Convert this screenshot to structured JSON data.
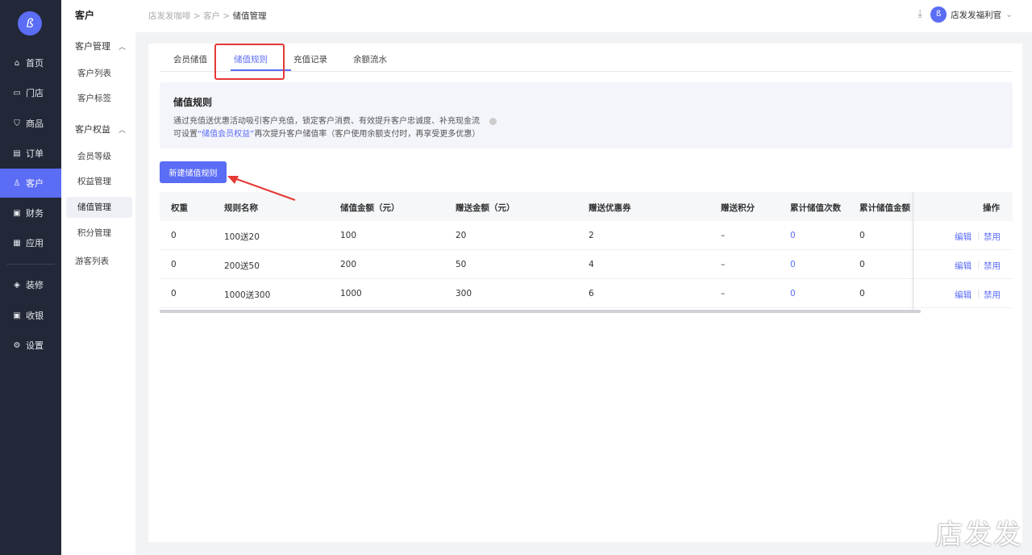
{
  "sidebar": {
    "items": [
      {
        "label": "首页",
        "icon": "⌂"
      },
      {
        "label": "门店",
        "icon": "▭"
      },
      {
        "label": "商品",
        "icon": "⛉"
      },
      {
        "label": "订单",
        "icon": "▤"
      },
      {
        "label": "客户",
        "icon": "♙"
      },
      {
        "label": "财务",
        "icon": "▣"
      },
      {
        "label": "应用",
        "icon": "▦"
      },
      {
        "label": "装修",
        "icon": "◈"
      },
      {
        "label": "收银",
        "icon": "▣"
      },
      {
        "label": "设置",
        "icon": "⚙"
      }
    ]
  },
  "subnav": {
    "title": "客户",
    "group1": "客户管理",
    "g1items": [
      "客户列表",
      "客户标签"
    ],
    "group2": "客户权益",
    "g2items": [
      "会员等级",
      "权益管理",
      "储值管理",
      "积分管理"
    ],
    "extra": "游客列表"
  },
  "header": {
    "crumb1": "店发发咖啡",
    "crumb2": "客户",
    "crumb3": "储值管理",
    "user": "店发发福利官"
  },
  "tabs": [
    "会员储值",
    "储值规则",
    "充值记录",
    "余额流水"
  ],
  "info": {
    "title": "储值规则",
    "line1": "通过充值送优惠活动吸引客户充值，锁定客户消费、有效提升客户忠诚度、补充现金流",
    "line2_pre": "可设置",
    "line2_link": "“储值会员权益”",
    "line2_post": "再次提升客户储值率（客户使用余额支付时，再享受更多优惠）"
  },
  "new_button": "新建储值规则",
  "table": {
    "headers": [
      "权重",
      "规则名称",
      "储值金额（元）",
      "赠送金额（元）",
      "赠送优惠券",
      "赠送积分",
      "累计储值次数",
      "累计储值金额",
      "操作"
    ],
    "rows": [
      [
        "0",
        "100送20",
        "100",
        "20",
        "2",
        "–",
        "0",
        "0"
      ],
      [
        "0",
        "200送50",
        "200",
        "50",
        "4",
        "–",
        "0",
        "0"
      ],
      [
        "0",
        "1000送300",
        "1000",
        "300",
        "6",
        "–",
        "0",
        "0"
      ]
    ],
    "edit": "编辑",
    "disable": "禁用"
  },
  "watermark": "店发发"
}
